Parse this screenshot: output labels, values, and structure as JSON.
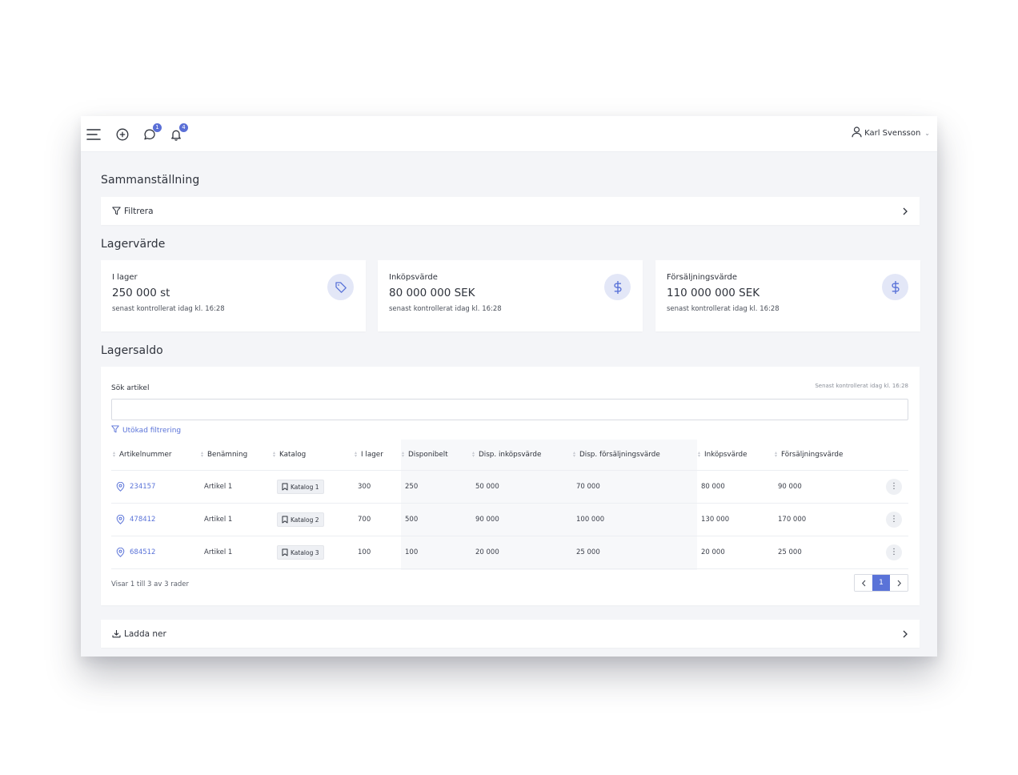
{
  "topbar": {
    "chat_badge": "1",
    "notif_badge": "4",
    "user_name": "Karl Svensson"
  },
  "summary": {
    "title": "Sammanställning",
    "filter_label": "Filtrera"
  },
  "stock_value": {
    "title": "Lagervärde",
    "cards": [
      {
        "label": "I lager",
        "value": "250 000 st",
        "note": "senast kontrollerat idag kl. 16:28",
        "icon": "tag-icon"
      },
      {
        "label": "Inköpsvärde",
        "value": "80 000 000 SEK",
        "note": "senast kontrollerat idag kl. 16:28",
        "icon": "dollar-icon"
      },
      {
        "label": "Försäljningsvärde",
        "value": "110 000 000 SEK",
        "note": "senast kontrollerat idag kl. 16:28",
        "icon": "dollar-icon"
      }
    ]
  },
  "stock_balance": {
    "title": "Lagersaldo",
    "search_label": "Sök artikel",
    "search_value": "",
    "checked_note": "Senast kontrollerat idag kl. 16:28",
    "advanced_filter": "Utökad filtrering",
    "columns": [
      "Artikelnummer",
      "Benämning",
      "Katalog",
      "I lager",
      "Disponibelt",
      "Disp. inköpsvärde",
      "Disp. försäljningsvärde",
      "Inköpsvärde",
      "Försäljningsvärde"
    ],
    "rows": [
      {
        "number": "234157",
        "name": "Artikel 1",
        "catalog": "Katalog 1",
        "in_stock": "300",
        "available": "250",
        "disp_purchase": "50 000",
        "disp_sales": "70 000",
        "purchase": "80 000",
        "sales": "90 000"
      },
      {
        "number": "478412",
        "name": "Artikel 1",
        "catalog": "Katalog 2",
        "in_stock": "700",
        "available": "500",
        "disp_purchase": "90 000",
        "disp_sales": "100 000",
        "purchase": "130 000",
        "sales": "170 000"
      },
      {
        "number": "684512",
        "name": "Artikel 1",
        "catalog": "Katalog 3",
        "in_stock": "100",
        "available": "100",
        "disp_purchase": "20 000",
        "disp_sales": "25 000",
        "purchase": "20 000",
        "sales": "25 000"
      }
    ],
    "footer_info": "Visar 1 till 3 av 3 rader",
    "current_page": "1"
  },
  "download": {
    "label": "Ladda ner"
  },
  "colors": {
    "accent": "#5a73d8",
    "icon_circle_bg": "#e3e7f7",
    "page_bg": "#f4f5f8"
  }
}
